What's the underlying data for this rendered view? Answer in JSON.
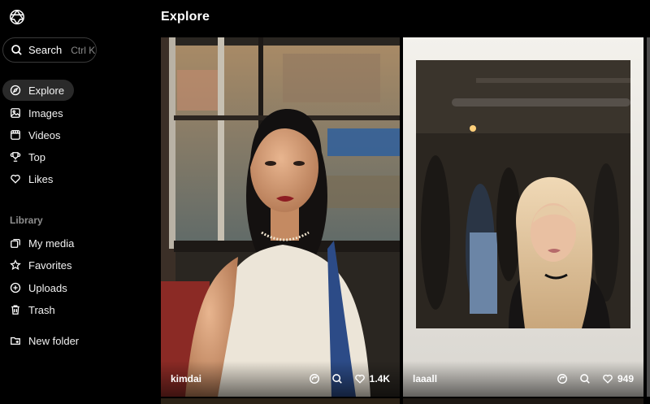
{
  "header": {
    "title": "Explore"
  },
  "search": {
    "label": "Search",
    "shortcut": "Ctrl K"
  },
  "nav": [
    {
      "label": "Explore",
      "icon": "compass-icon",
      "active": true
    },
    {
      "label": "Images",
      "icon": "image-icon"
    },
    {
      "label": "Videos",
      "icon": "video-icon"
    },
    {
      "label": "Top",
      "icon": "trophy-icon"
    },
    {
      "label": "Likes",
      "icon": "heart-icon"
    }
  ],
  "library": {
    "label": "Library",
    "items": [
      {
        "label": "My media",
        "icon": "media-icon"
      },
      {
        "label": "Favorites",
        "icon": "star-icon"
      },
      {
        "label": "Uploads",
        "icon": "upload-icon"
      },
      {
        "label": "Trash",
        "icon": "trash-icon"
      },
      {
        "label": "New folder",
        "icon": "new-folder-icon"
      }
    ]
  },
  "cards": [
    {
      "author": "kimdai",
      "likes": "1.4K"
    },
    {
      "author": "laaall",
      "likes": "949"
    }
  ],
  "colors": {
    "background": "#000000",
    "active_nav": "#2a2a2a",
    "muted_text": "#8f8f8f"
  }
}
